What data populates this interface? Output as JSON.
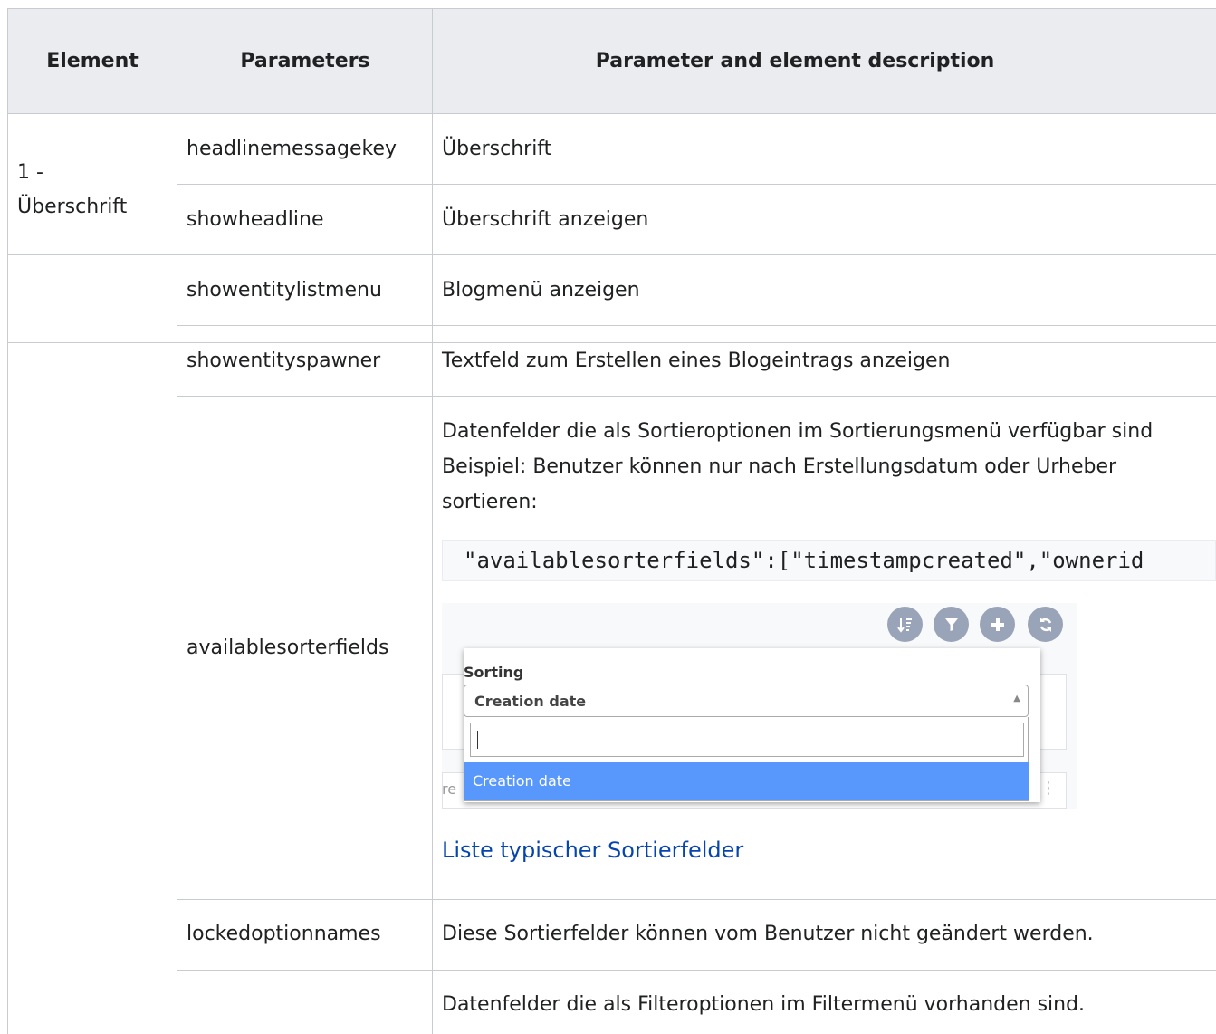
{
  "table": {
    "headers": [
      "Element",
      "Parameters",
      "Parameter and element description"
    ],
    "rows": [
      {
        "element": "1 -\nÜberschrift",
        "param": "headlinemessagekey",
        "desc": "Überschrift"
      },
      {
        "element": "",
        "param": "showheadline",
        "desc": "Überschrift anzeigen"
      },
      {
        "element": "",
        "param": "showentitylistmenu",
        "desc": "Blogmenü anzeigen"
      },
      {
        "element": "",
        "param": "showentityspawner",
        "desc": "Textfeld zum Erstellen eines Blogeintrags anzeigen"
      },
      {
        "element": "",
        "param": "availablesorterfields",
        "desc_lines": [
          "Datenfelder die als Sortieroptionen im Sortierungsmenü verfügbar sind",
          "Beispiel: Benutzer können nur nach Erstellungsdatum oder Urheber",
          "sortieren:"
        ],
        "code": "\"availablesorterfields\":[\"timestampcreated\",\"ownerid",
        "screenshot": {
          "icons": [
            "sort-icon",
            "filter-icon",
            "plus-icon",
            "refresh-icon"
          ],
          "label": "Sorting",
          "selected": "Creation date",
          "search_value": "",
          "option": "Creation date",
          "behind_text": "re"
        },
        "link": "Liste typischer Sortierfelder"
      },
      {
        "element": "",
        "param": "lockedoptionnames",
        "desc": "Diese Sortierfelder können vom Benutzer nicht geändert werden."
      },
      {
        "element": "",
        "param": "",
        "desc": "Datenfelder die als Filteroptionen im Filtermenü vorhanden sind."
      }
    ]
  },
  "colors": {
    "header_bg": "#eaecf0",
    "border": "#c8ccd1",
    "link": "#0645ad",
    "highlight": "#5897fb"
  }
}
